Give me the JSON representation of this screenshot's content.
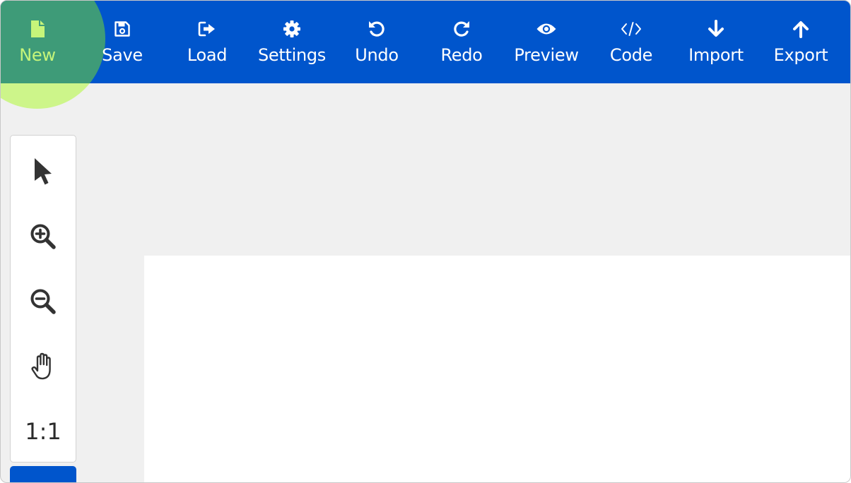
{
  "toolbar": {
    "background": "#0055cc",
    "active_color": "#c6f57a",
    "buttons": [
      {
        "id": "new",
        "label": "New",
        "icon": "file-icon"
      },
      {
        "id": "save",
        "label": "Save",
        "icon": "floppy-disk-icon"
      },
      {
        "id": "load",
        "label": "Load",
        "icon": "sign-in-icon"
      },
      {
        "id": "settings",
        "label": "Settings",
        "icon": "gear-icon"
      },
      {
        "id": "undo",
        "label": "Undo",
        "icon": "undo-icon"
      },
      {
        "id": "redo",
        "label": "Redo",
        "icon": "redo-icon"
      },
      {
        "id": "preview",
        "label": "Preview",
        "icon": "eye-icon"
      },
      {
        "id": "code",
        "label": "Code",
        "icon": "code-icon"
      },
      {
        "id": "import",
        "label": "Import",
        "icon": "arrow-down-icon"
      },
      {
        "id": "export",
        "label": "Export",
        "icon": "arrow-up-icon"
      }
    ]
  },
  "sidebar": {
    "tools": [
      {
        "id": "select",
        "icon": "cursor-pointer-icon"
      },
      {
        "id": "zoom-in",
        "icon": "zoom-in-icon"
      },
      {
        "id": "zoom-out",
        "icon": "zoom-out-icon"
      },
      {
        "id": "pan",
        "icon": "hand-icon"
      },
      {
        "id": "actual-size",
        "label": "1:1"
      }
    ]
  }
}
